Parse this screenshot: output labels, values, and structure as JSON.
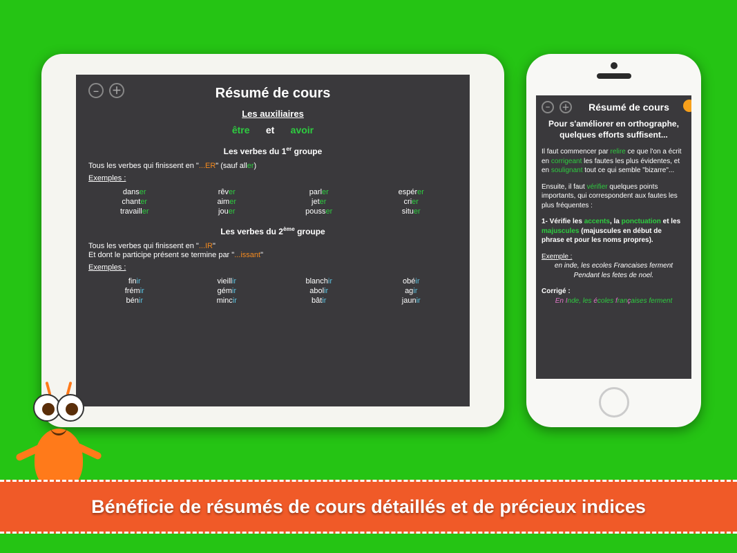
{
  "banner": {
    "text": "Bénéficie de résumés de cours détaillés et de précieux indices"
  },
  "tablet": {
    "title": "Résumé de cours",
    "subtitle": "Les auxiliaires",
    "aux_etre": "être",
    "aux_et": "et",
    "aux_avoir": "avoir",
    "group1_title_prefix": "Les verbes du 1",
    "group1_title_sup": "er",
    "group1_title_suffix": " groupe",
    "group1_rule_a": "Tous les verbes qui finissent en \"",
    "group1_rule_b": "...ER",
    "group1_rule_c": "\" (sauf all",
    "group1_rule_d": "er",
    "group1_rule_e": ")",
    "examples_label": "Exemples :",
    "g1_verbs": [
      {
        "stem": "dans",
        "end": "er"
      },
      {
        "stem": "rêv",
        "end": "er"
      },
      {
        "stem": "parl",
        "end": "er"
      },
      {
        "stem": "espér",
        "end": "er"
      },
      {
        "stem": "chant",
        "end": "er"
      },
      {
        "stem": "aim",
        "end": "er"
      },
      {
        "stem": "jet",
        "end": "er"
      },
      {
        "stem": "cri",
        "end": "er"
      },
      {
        "stem": "travaill",
        "end": "er"
      },
      {
        "stem": "jou",
        "end": "er"
      },
      {
        "stem": "pouss",
        "end": "er"
      },
      {
        "stem": "situ",
        "end": "er"
      }
    ],
    "group2_title_prefix": "Les verbes du 2",
    "group2_title_sup": "ème",
    "group2_title_suffix": " groupe",
    "group2_rule1_a": "Tous les verbes qui finissent en \"",
    "group2_rule1_b": "...IR",
    "group2_rule1_c": "\"",
    "group2_rule2_a": "Et dont le participe présent se termine par \"",
    "group2_rule2_b": "...issant",
    "group2_rule2_c": "\"",
    "g2_verbs": [
      {
        "stem": "fin",
        "end": "ir"
      },
      {
        "stem": "vieill",
        "end": "ir"
      },
      {
        "stem": "blanch",
        "end": "ir"
      },
      {
        "stem": "obé",
        "end": "ir"
      },
      {
        "stem": "frém",
        "end": "ir"
      },
      {
        "stem": "gém",
        "end": "ir"
      },
      {
        "stem": "abol",
        "end": "ir"
      },
      {
        "stem": "ag",
        "end": "ir"
      },
      {
        "stem": "bén",
        "end": "ir"
      },
      {
        "stem": "minc",
        "end": "ir"
      },
      {
        "stem": "bât",
        "end": "ir"
      },
      {
        "stem": "jaun",
        "end": "ir"
      }
    ]
  },
  "phone": {
    "title": "Résumé de cours",
    "subtitle": "Pour s'améliorer en orthographe, quelques efforts suffisent...",
    "p1_a": "Il faut commencer par ",
    "p1_b": "relire",
    "p1_c": " ce que l'on a écrit en ",
    "p1_d": "corrigeant",
    "p1_e": " les fautes les plus évidentes, et en ",
    "p1_f": "soulignant",
    "p1_g": " tout ce qui semble \"bizarre\"...",
    "p2_a": "Ensuite, il faut ",
    "p2_b": "vérifier",
    "p2_c": " quelques points importants, qui correspondent aux fautes les plus fréquentes :",
    "p3_a": "1- Vérifie les ",
    "p3_b": "accents",
    "p3_c": ", la ",
    "p3_d": "ponctuation",
    "p3_e": " et les ",
    "p3_f": "majuscules",
    "p3_g": " (majuscules en début de phrase et pour les noms propres).",
    "example_label": "Exemple :",
    "example_text": "en inde, les ecoles Francaises ferment Pendant les fetes de noel.",
    "corrige_label": "Corrigé :",
    "corr_a": "En ",
    "corr_b": "I",
    "corr_c": "nde, les ",
    "corr_d": "é",
    "corr_e": "coles ",
    "corr_f": "f",
    "corr_g": "ran",
    "corr_h": "ç",
    "corr_i": "aises ferment"
  },
  "glyphs": {
    "minus": "–",
    "plus": "＋"
  }
}
